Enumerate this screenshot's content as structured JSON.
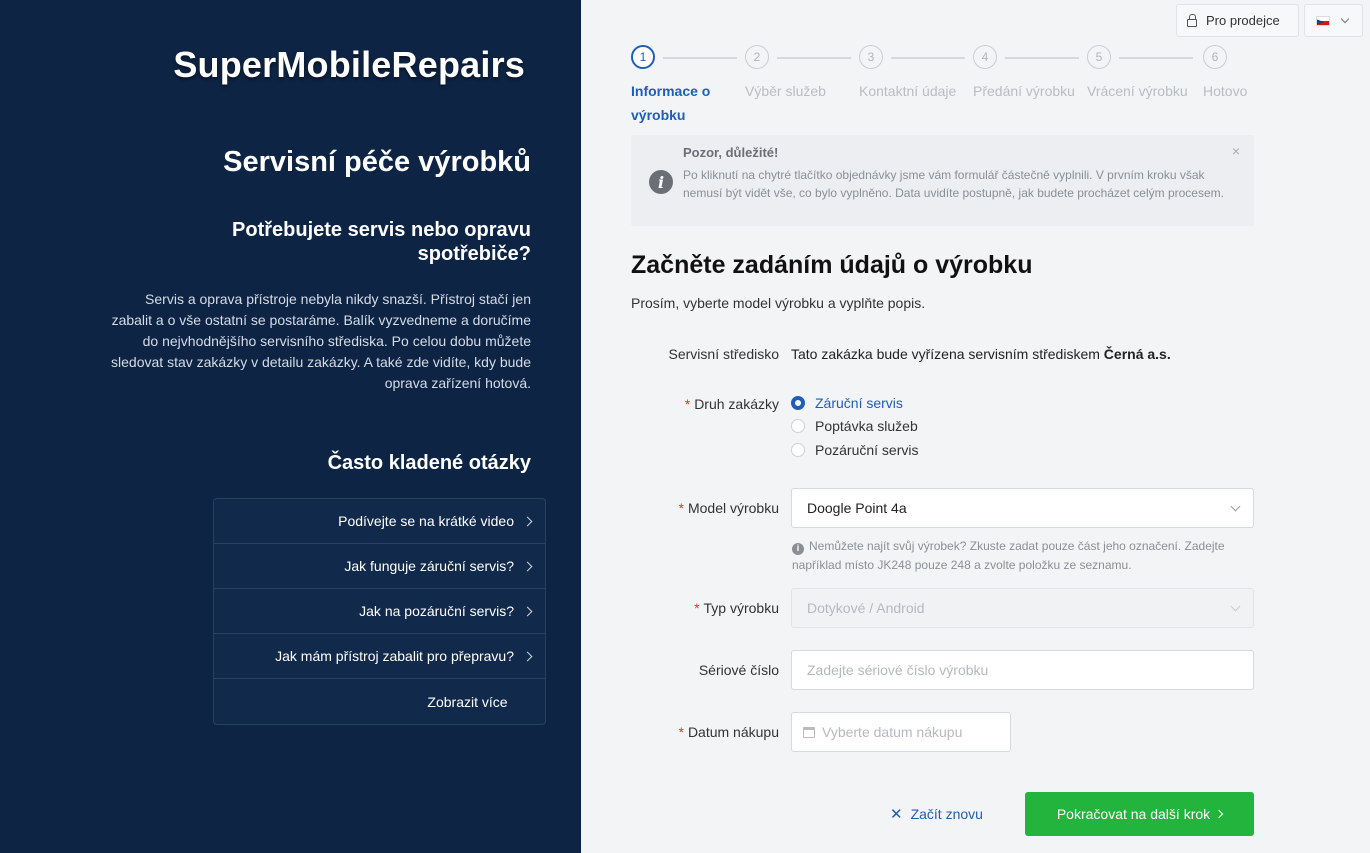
{
  "brand": "SuperMobileRepairs",
  "left": {
    "title": "Servisní péče výrobků",
    "subtitle": "Potřebujete servis nebo opravu spotřebiče?",
    "text": "Servis a oprava přístroje nebyla nikdy snazší. Přístroj stačí jen zabalit a o vše ostatní se postaráme. Balík vyzvedneme a doručíme do nejvhodnějšího servisního střediska. Po celou dobu můžete sledovat stav zakázky v detailu zakázky. A také zde vidíte, kdy bude oprava zařízení hotová.",
    "faq_title": "Často kladené otázky",
    "faq": [
      {
        "label": "Podívejte se na krátké video",
        "icon": "chevron-right-icon"
      },
      {
        "label": "Jak funguje záruční servis?",
        "icon": "chevron-right-icon"
      },
      {
        "label": "Jak na pozáruční servis?",
        "icon": "chevron-right-icon"
      },
      {
        "label": "Jak mám přístroj zabalit pro přepravu?",
        "icon": "chevron-right-icon"
      }
    ],
    "faq_more": "Zobrazit více"
  },
  "topbar": {
    "seller_label": "Pro prodejce",
    "seller_icon": "lock-icon",
    "language_icon": "czech-flag-icon"
  },
  "steps": [
    {
      "num": "1",
      "label": "Informace o výrobku",
      "active": true
    },
    {
      "num": "2",
      "label": "Výběr služeb",
      "active": false
    },
    {
      "num": "3",
      "label": "Kontaktní údaje",
      "active": false
    },
    {
      "num": "4",
      "label": "Předání výrobku",
      "active": false
    },
    {
      "num": "5",
      "label": "Vrácení výrobku",
      "active": false
    },
    {
      "num": "6",
      "label": "Hotovo",
      "active": false
    }
  ],
  "alert": {
    "title": "Pozor, důležité!",
    "text": "Po kliknutí na chytré tlačítko objednávky jsme vám formulář částečně vyplnili. V prvním kroku však nemusí být vidět vše, co bylo vyplněno. Data uvidíte postupně, jak budete procházet celým procesem.",
    "close": "×"
  },
  "main": {
    "title": "Začněte zadáním údajů o výrobku",
    "subtitle": "Prosím, vyberte model výrobku a vyplňte popis."
  },
  "form": {
    "service_center": {
      "label": "Servisní středisko",
      "text": "Tato zakázka bude vyřízena servisním střediskem ",
      "center": "Černá a.s."
    },
    "order_type": {
      "label": "Druh zakázky",
      "options": [
        "Záruční servis",
        "Poptávka služeb",
        "Pozáruční servis"
      ],
      "selected": "Záruční servis"
    },
    "model": {
      "label": "Model výrobku",
      "value": "Doogle Point 4a",
      "hint": "Nemůžete najít svůj výrobek? Zkuste zadat pouze část jeho označení. Zadejte například místo JK248 pouze 248 a zvolte položku ze seznamu."
    },
    "product_type": {
      "label": "Typ výrobku",
      "value": "Dotykové / Android"
    },
    "serial": {
      "label": "Sériové číslo",
      "placeholder": "Zadejte sériové číslo výrobku"
    },
    "purchase_date": {
      "label": "Datum nákupu",
      "placeholder": "Vyberte datum nákupu"
    },
    "required_mark": "*"
  },
  "actions": {
    "restart": "Začít znovu",
    "next": "Pokračovat na další krok"
  },
  "colors": {
    "sidebar": "#0e2444",
    "accent": "#1e5eb8",
    "primary_button": "#22b43d",
    "required": "#e03131"
  }
}
